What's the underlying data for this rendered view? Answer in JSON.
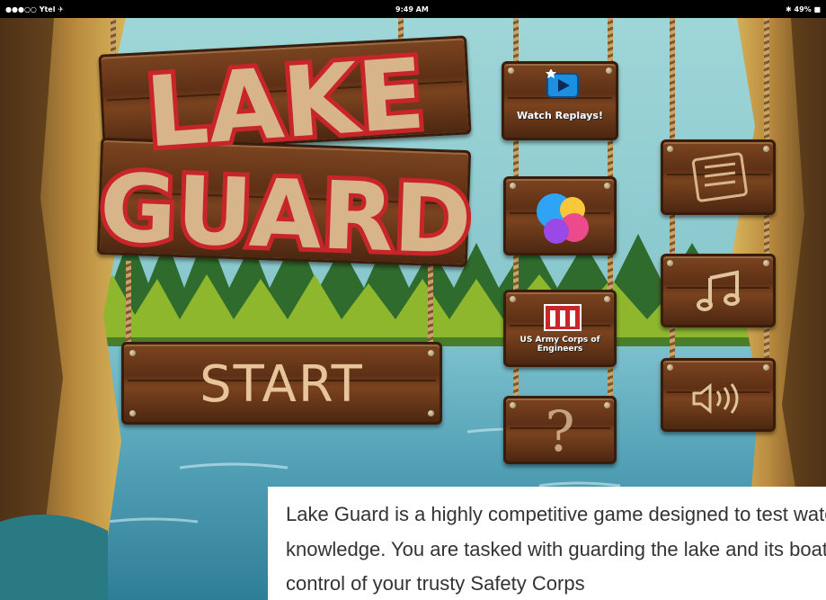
{
  "status_bar": {
    "carrier": "●●●○○ Ytel ✈",
    "time": "9:49 AM",
    "battery": "✱ 49% ■"
  },
  "game": {
    "title_line1": "LAKE",
    "title_line2": "GUARD",
    "start_label": "START",
    "watch_replays_label": "Watch Replays!",
    "corps_label": "US Army Corps of Engineers",
    "help_symbol": "?",
    "icons": {
      "replays": "play-screen-icon",
      "game_center": "game-center-bubbles-icon",
      "corps": "castle-icon",
      "help": "question-mark-icon",
      "leaderboard": "list-icon",
      "music": "music-note-icon",
      "sound": "speaker-icon"
    },
    "colors": {
      "sky": "#7fc3c9",
      "water": "#5aa5b7",
      "wood": "#6b3a1a",
      "title_outline": "#c8252b"
    }
  },
  "description": {
    "text": "Lake Guard is a highly competitive game designed to test water safety knowledge. You are tasked with guarding the lake and its boaters. Take control of your trusty Safety Corps"
  }
}
